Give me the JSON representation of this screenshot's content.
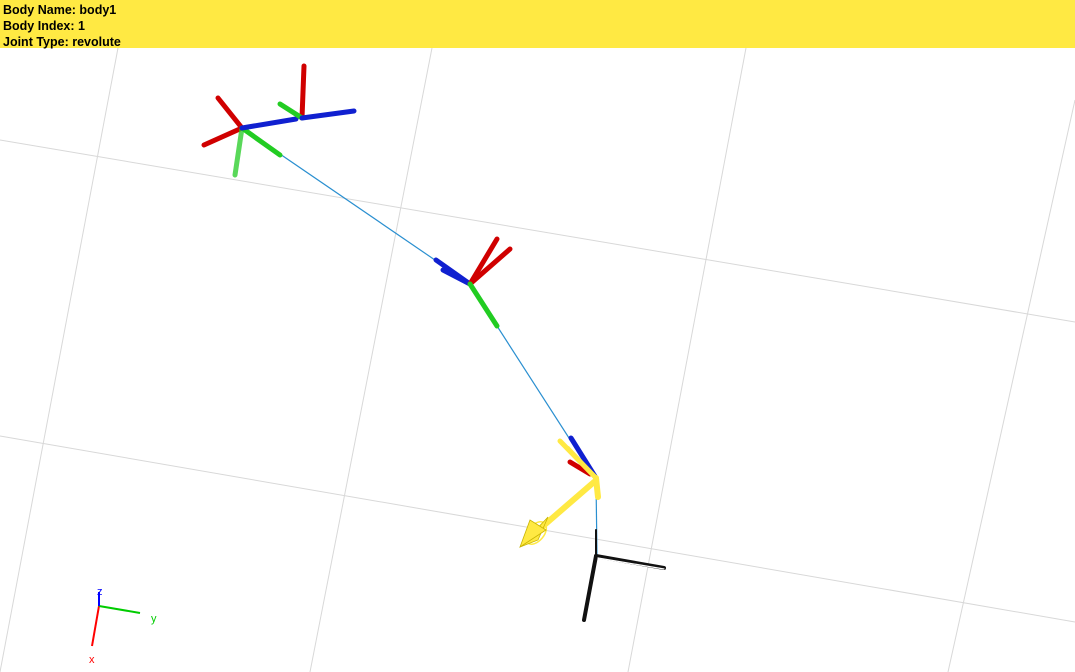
{
  "info_panel": {
    "background": "#ffe943",
    "lines": [
      {
        "label": "Body Name:",
        "value": "body1"
      },
      {
        "label": "Body Index:",
        "value": "1"
      },
      {
        "label": "Joint Type:",
        "value": "revolute"
      }
    ]
  },
  "triad": {
    "x_label": "x",
    "y_label": "y",
    "z_label": "z",
    "x_color": "#ff0000",
    "y_color": "#00cc00",
    "z_color": "#0000ff"
  },
  "colors": {
    "frame_x": "#d00000",
    "frame_y": "#22cc22",
    "frame_z": "#1020d0",
    "connector": "#2a8fd0",
    "highlight": "#ffe943",
    "ground": "#111111",
    "grid": "#d8d8d8"
  }
}
